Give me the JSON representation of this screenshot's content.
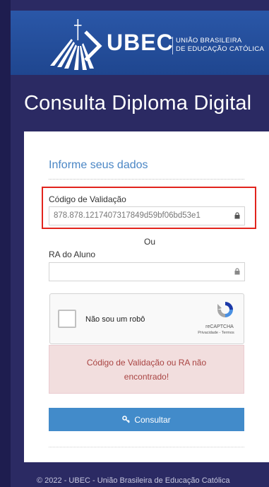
{
  "header": {
    "logo_word": "UBEC",
    "logo_sub_line1": "UNIÃO BRASILEIRA",
    "logo_sub_line2": "DE EDUCAÇÃO CATÓLICA"
  },
  "page_title": "Consulta Diploma Digital",
  "form": {
    "section_title": "Informe seus dados",
    "codigo_label": "Código de Validação",
    "codigo_value": "878.878.1217407317849d59bf06bd53e1",
    "ou_text": "Ou",
    "ra_label": "RA do Aluno",
    "ra_value": "",
    "captcha": {
      "label": "Não sou um robô",
      "brand": "reCAPTCHA",
      "links": "Privacidade - Termos"
    },
    "alert_text": "Código de Validação ou RA não encontrado!",
    "submit_label": "Consultar"
  },
  "footer_text": "© 2022 - UBEC - União Brasileira de Educação Católica",
  "colors": {
    "background": "#1e1d4f",
    "header": "#1f468f",
    "accent": "#428bca",
    "alert_bg": "#f2dede",
    "alert_text": "#a94442",
    "highlight": "#e2241d"
  }
}
